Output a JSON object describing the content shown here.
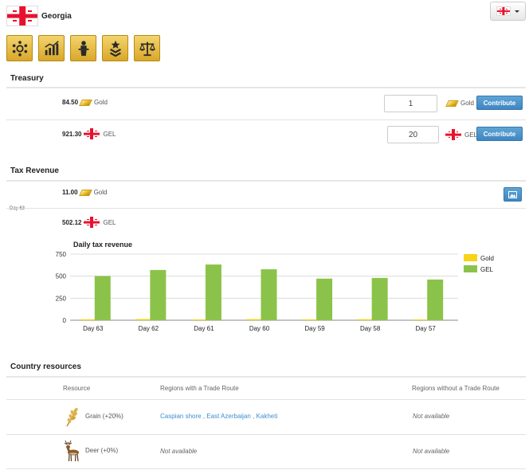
{
  "header": {
    "country": "Georgia"
  },
  "toolbar": {
    "buttons": [
      "government-icon",
      "economy-chart-icon",
      "president-icon",
      "military-rank-icon",
      "justice-scales-icon"
    ]
  },
  "treasury": {
    "title": "Treasury",
    "rows": [
      {
        "amount": "84.50",
        "unit": "Gold",
        "input": "1",
        "input_unit": "Gold",
        "button": "Contribute"
      },
      {
        "amount": "921.30",
        "unit": "GEL",
        "input": "20",
        "input_unit": "GEL",
        "button": "Contribute"
      }
    ]
  },
  "tax_revenue": {
    "title": "Tax Revenue",
    "day": "Day 63",
    "rows": [
      {
        "amount": "11.00",
        "unit": "Gold"
      },
      {
        "amount": "502.12",
        "unit": "GEL"
      }
    ]
  },
  "chart_data": {
    "type": "bar",
    "title": "Daily tax revenue",
    "categories": [
      "Day 63",
      "Day 62",
      "Day 61",
      "Day 60",
      "Day 59",
      "Day 58",
      "Day 57"
    ],
    "series": [
      {
        "name": "Gold",
        "values": [
          11,
          14,
          9,
          13,
          10,
          12,
          9
        ],
        "color": "#f7d417"
      },
      {
        "name": "GEL",
        "values": [
          502,
          570,
          632,
          578,
          472,
          480,
          462
        ],
        "color": "#8bc34a"
      }
    ],
    "yticks": [
      "0",
      "250",
      "500",
      "750"
    ],
    "ylim": [
      0,
      750
    ],
    "grid": true,
    "legend": "right"
  },
  "resources": {
    "title": "Country resources",
    "headers": {
      "resource": "Resource",
      "with_route": "Regions with a Trade Route",
      "without_route": "Regions without a Trade Route"
    },
    "rows": [
      {
        "icon": "grain-icon",
        "name": "Grain (+20%)",
        "with_route": [
          {
            "text": "Caspian shore",
            "sep": " , "
          },
          {
            "text": "East Azerbaijan",
            "sep": " , "
          },
          {
            "text": "Kakheti",
            "sep": ""
          }
        ],
        "without_route": "Not available"
      },
      {
        "icon": "deer-icon",
        "name": "Deer (+0%)",
        "with_route_text": "Not available",
        "without_route": "Not available"
      }
    ]
  }
}
